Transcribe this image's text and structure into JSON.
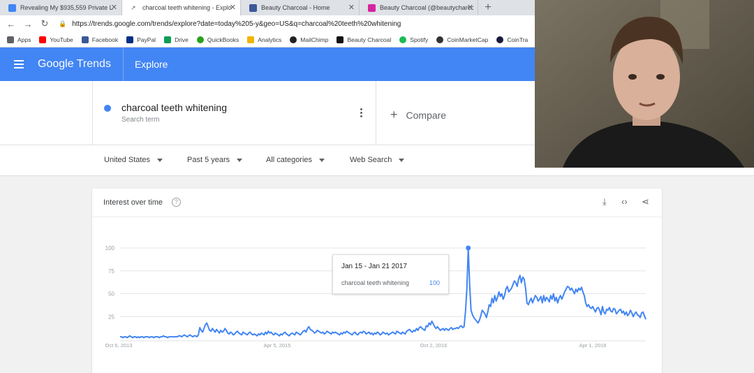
{
  "browser": {
    "tabs": [
      {
        "title": "Revealing My $935,559 Private L",
        "icon_color": "#4285f4"
      },
      {
        "title": "charcoal teeth whitening - Explo",
        "icon_color": "#5f6368",
        "active": true
      },
      {
        "title": "Beauty Charcoal - Home",
        "icon_color": "#3b5998"
      },
      {
        "title": "Beauty Charcoal (@beautycharco",
        "icon_color": "#d6249f"
      }
    ],
    "url": "https://trends.google.com/trends/explore?date=today%205-y&geo=US&q=charcoal%20teeth%20whitening",
    "bookmarks": [
      {
        "label": "Apps",
        "icon_color": "#5f6368"
      },
      {
        "label": "YouTube",
        "icon_color": "#ff0000"
      },
      {
        "label": "Facebook",
        "icon_color": "#3b5998"
      },
      {
        "label": "PayPal",
        "icon_color": "#003087"
      },
      {
        "label": "Drive",
        "icon_color": "#0f9d58"
      },
      {
        "label": "QuickBooks",
        "icon_color": "#2ca01c"
      },
      {
        "label": "Analytics",
        "icon_color": "#f4b400"
      },
      {
        "label": "MailChimp",
        "icon_color": "#222222"
      },
      {
        "label": "Beauty Charcoal",
        "icon_color": "#111111"
      },
      {
        "label": "Spotify",
        "icon_color": "#1db954"
      },
      {
        "label": "CoinMarketCap",
        "icon_color": "#333333"
      },
      {
        "label": "CoinTra",
        "icon_color": "#1a1a40"
      }
    ]
  },
  "header": {
    "logo_google": "Google",
    "logo_trends": "Trends",
    "section": "Explore",
    "color": "#4285f4"
  },
  "term": {
    "name": "charcoal teeth whitening",
    "sublabel": "Search term",
    "dot_color": "#4285f4",
    "compare": "Compare"
  },
  "filters": {
    "region": "United States",
    "time": "Past 5 years",
    "category": "All categories",
    "search_type": "Web Search"
  },
  "card": {
    "title": "Interest over time"
  },
  "tooltip": {
    "date": "Jan 15 - Jan 21 2017",
    "term": "charcoal teeth whitening",
    "value": "100"
  },
  "chart_data": {
    "type": "line",
    "y_ticks": [
      "100",
      "75",
      "50",
      "25"
    ],
    "ylim": [
      0,
      100
    ],
    "x_tick_labels": [
      "Oct 6, 2013",
      "Apr 5, 2015",
      "Oct 2, 2016",
      "Apr 1, 2018"
    ],
    "grid": true,
    "series": [
      {
        "color": "#4285f4",
        "values": [
          3,
          3,
          2,
          3,
          3,
          2,
          3,
          4,
          3,
          2,
          3,
          3,
          2,
          3,
          2,
          3,
          3,
          2,
          3,
          3,
          3,
          2,
          3,
          3,
          2,
          3,
          3,
          3,
          2,
          3,
          3,
          4,
          3,
          3,
          2,
          3,
          3,
          3,
          3,
          3,
          3,
          3,
          4,
          4,
          3,
          4,
          5,
          4,
          3,
          4,
          5,
          4,
          3,
          4,
          4,
          3,
          5,
          13,
          10,
          8,
          12,
          16,
          18,
          14,
          10,
          9,
          12,
          10,
          8,
          11,
          9,
          7,
          10,
          8,
          9,
          12,
          10,
          7,
          6,
          8,
          7,
          5,
          6,
          8,
          9,
          7,
          6,
          5,
          8,
          7,
          6,
          5,
          7,
          8,
          6,
          5,
          6,
          5,
          4,
          6,
          5,
          7,
          6,
          5,
          8,
          6,
          9,
          7,
          8,
          6,
          5,
          7,
          6,
          5,
          4,
          6,
          5,
          7,
          8,
          6,
          5,
          4,
          6,
          7,
          6,
          5,
          8,
          7,
          6,
          5,
          7,
          9,
          10,
          8,
          12,
          14,
          11,
          10,
          9,
          7,
          8,
          10,
          9,
          8,
          7,
          8,
          6,
          7,
          9,
          8,
          7,
          6,
          8,
          7,
          8,
          7,
          6,
          5,
          7,
          6,
          8,
          7,
          9,
          8,
          7,
          6,
          5,
          7,
          8,
          6,
          5,
          7,
          8,
          7,
          9,
          8,
          6,
          7,
          8,
          6,
          7,
          5,
          7,
          6,
          8,
          7,
          5,
          6,
          8,
          7,
          6,
          7,
          5,
          6,
          7,
          8,
          7,
          6,
          9,
          8,
          7,
          6,
          8,
          7,
          6,
          9,
          10,
          11,
          9,
          8,
          10,
          9,
          12,
          10,
          13,
          14,
          12,
          11,
          10,
          15,
          14,
          18,
          16,
          20,
          17,
          14,
          12,
          14,
          12,
          10,
          11,
          12,
          10,
          12,
          11,
          10,
          12,
          13,
          11,
          12,
          12,
          13,
          12,
          14,
          15,
          13,
          14,
          30,
          55,
          100,
          60,
          32,
          27,
          24,
          22,
          20,
          18,
          21,
          26,
          32,
          30,
          28,
          24,
          30,
          38,
          36,
          45,
          40,
          48,
          42,
          46,
          52,
          47,
          50,
          44,
          48,
          55,
          58,
          52,
          54,
          56,
          60,
          64,
          62,
          58,
          66,
          70,
          62,
          68,
          66,
          56,
          40,
          38,
          42,
          45,
          40,
          44,
          48,
          46,
          42,
          44,
          47,
          40,
          48,
          42,
          46,
          44,
          41,
          48,
          44,
          50,
          42,
          46,
          40,
          45,
          48,
          44,
          48,
          52,
          55,
          58,
          57,
          54,
          56,
          53,
          50,
          55,
          52,
          56,
          54,
          57,
          52,
          48,
          40,
          36,
          38,
          35,
          34,
          36,
          33,
          30,
          34,
          35,
          32,
          27,
          36,
          30,
          28,
          33,
          32,
          35,
          31,
          30,
          34,
          33,
          28,
          30,
          32,
          33,
          29,
          31,
          27,
          30,
          26,
          28,
          32,
          29,
          25,
          28,
          30,
          27,
          26,
          24,
          29,
          30,
          26,
          22
        ]
      }
    ]
  }
}
